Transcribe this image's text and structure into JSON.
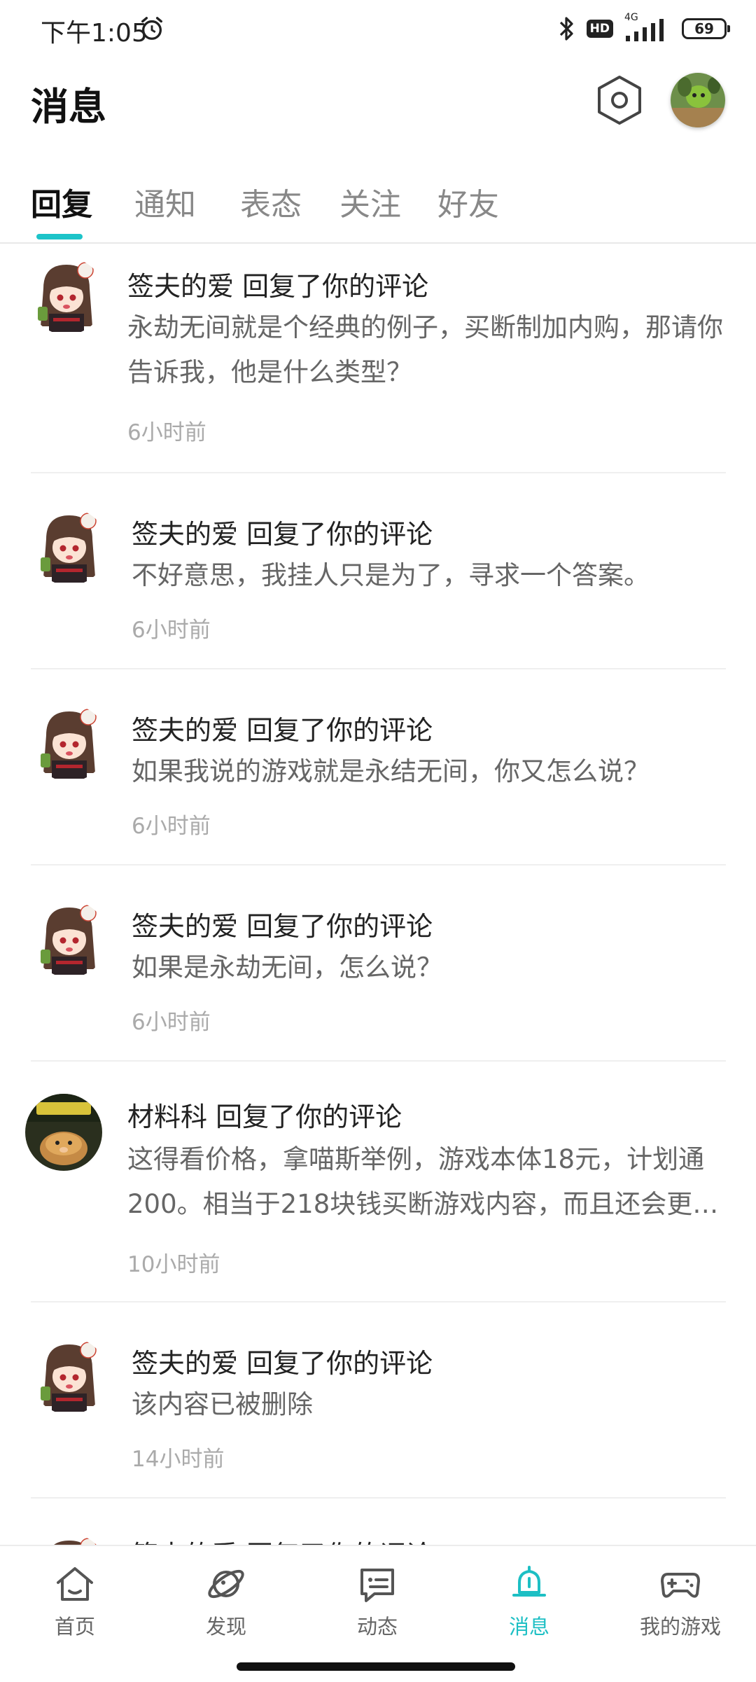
{
  "status_bar": {
    "time": "下午1:05",
    "network": "4G",
    "hd": "HD",
    "battery": "69"
  },
  "header": {
    "title": "消息"
  },
  "tabs": [
    {
      "label": "回复",
      "active": true
    },
    {
      "label": "通知",
      "active": false
    },
    {
      "label": "表态",
      "active": false
    },
    {
      "label": "关注",
      "active": false
    },
    {
      "label": "好友",
      "active": false
    }
  ],
  "messages": [
    {
      "user": "签夫的爱",
      "action": "回复了你的评论",
      "title": "签夫的爱 回复了你的评论",
      "body": "永劫无间就是个经典的例子，买断制加内购，那请你告诉我，他是什么类型？",
      "time": "6小时前"
    },
    {
      "user": "签夫的爱",
      "action": "回复了你的评论",
      "title": "签夫的爱 回复了你的评论",
      "body": "不好意思，我挂人只是为了，寻求一个答案。",
      "time": "6小时前"
    },
    {
      "user": "签夫的爱",
      "action": "回复了你的评论",
      "title": "签夫的爱 回复了你的评论",
      "body": "如果我说的游戏就是永结无间，你又怎么说？",
      "time": "6小时前"
    },
    {
      "user": "签夫的爱",
      "action": "回复了你的评论",
      "title": "签夫的爱 回复了你的评论",
      "body": "如果是永劫无间，怎么说？",
      "time": "6小时前"
    },
    {
      "user": "材料科",
      "action": "回复了你的评论",
      "title": "材料科 回复了你的评论",
      "body": "这得看价格，拿喵斯举例，游戏本体18元，计划通200。相当于218块钱买断游戏内容，而且还会更新新内容",
      "time": "10小时前"
    },
    {
      "user": "签夫的爱",
      "action": "回复了你的评论",
      "title": "签夫的爱 回复了你的评论",
      "body": "该内容已被删除",
      "time": "14小时前"
    },
    {
      "user": "签夫的爱",
      "action": "回复了你的评论",
      "title": "签夫的爱 回复了你的评论",
      "body": "",
      "time": ""
    }
  ],
  "nav": [
    {
      "label": "首页",
      "icon": "home-icon",
      "active": false
    },
    {
      "label": "发现",
      "icon": "planet-icon",
      "active": false
    },
    {
      "label": "动态",
      "icon": "chat-card-icon",
      "active": false
    },
    {
      "label": "消息",
      "icon": "bell-icon",
      "active": true
    },
    {
      "label": "我的游戏",
      "icon": "gamepad-icon",
      "active": false
    }
  ],
  "colors": {
    "accent": "#1dc4c9",
    "text_primary": "#222222",
    "text_secondary": "#666666",
    "text_muted": "#aaaaaa"
  }
}
